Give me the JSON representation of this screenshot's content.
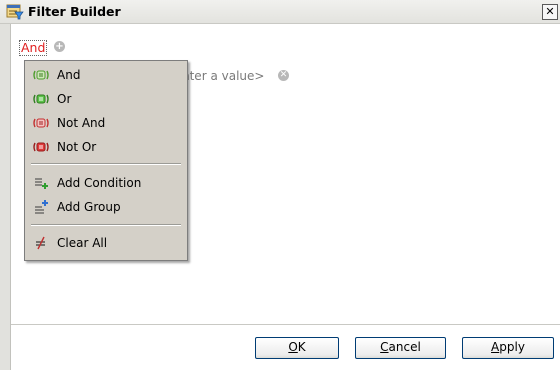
{
  "window": {
    "title": "Filter Builder",
    "close_glyph": "✕"
  },
  "filter": {
    "group_operator": "And",
    "add_glyph": "+",
    "value_placeholder": "nter a value>",
    "remove_glyph": "✕"
  },
  "context_menu": {
    "items": [
      {
        "label": "And",
        "icon": "and-group-icon"
      },
      {
        "label": "Or",
        "icon": "or-group-icon"
      },
      {
        "label": "Not And",
        "icon": "not-and-group-icon"
      },
      {
        "label": "Not Or",
        "icon": "not-or-group-icon"
      },
      {
        "label": "Add Condition",
        "icon": "add-condition-icon"
      },
      {
        "label": "Add Group",
        "icon": "add-group-icon"
      },
      {
        "label": "Clear All",
        "icon": "clear-all-icon"
      }
    ]
  },
  "buttons": {
    "ok": {
      "mnemonic": "O",
      "rest": "K"
    },
    "cancel": {
      "mnemonic": "C",
      "rest": "ancel"
    },
    "apply": {
      "mnemonic": "A",
      "rest": "pply"
    }
  },
  "colors": {
    "and_operator": "#e02020",
    "menu_background": "#d4d0c8",
    "button_border": "#003c74"
  }
}
